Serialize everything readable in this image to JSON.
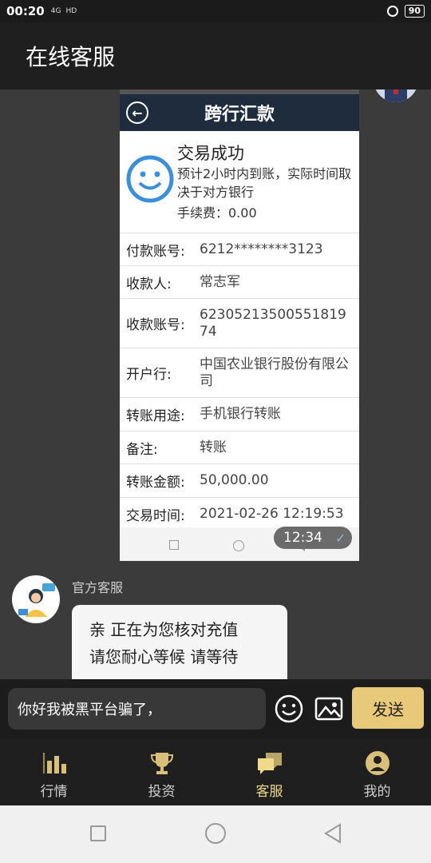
{
  "status_bar": {
    "time": "00:20",
    "signal": "4G",
    "network": "HD",
    "battery": "90"
  },
  "app_bar": {
    "title": "在线客服"
  },
  "chat": {
    "screenshot": {
      "header_title": "跨行汇款",
      "success_title": "交易成功",
      "success_desc": "预计2小时内到账，实际时间取决于对方银行",
      "fee": "手续费：0.00",
      "rows": [
        {
          "label": "付款账号:",
          "value": "6212********3123"
        },
        {
          "label": "收款人:",
          "value": "常志军"
        },
        {
          "label": "收款账号:",
          "value": "6230521350055181974"
        },
        {
          "label": "开户行:",
          "value": "中国农业银行股份有限公司"
        },
        {
          "label": "转账用途:",
          "value": "手机银行转账"
        },
        {
          "label": "备注:",
          "value": "转账"
        },
        {
          "label": "转账金额:",
          "value": "50,000.00"
        },
        {
          "label": "交易时间:",
          "value": "2021-02-26 12:19:53"
        }
      ],
      "timestamp": "12:34"
    },
    "agent_name": "官方客服",
    "agent_message_line1": "亲 正在为您核对充值",
    "agent_message_line2": "请您耐心等候 请等待"
  },
  "input": {
    "value": "你好我被黑平台骗了，",
    "send_label": "发送"
  },
  "tabs": [
    {
      "label": "行情",
      "icon": "bar-chart-icon"
    },
    {
      "label": "投资",
      "icon": "trophy-icon"
    },
    {
      "label": "客服",
      "icon": "chat-bubbles-icon",
      "active": true
    },
    {
      "label": "我的",
      "icon": "user-icon"
    }
  ],
  "colors": {
    "accent": "#e8c97a",
    "active_tab": "#f0d98a",
    "background": "#3b3b3b"
  }
}
